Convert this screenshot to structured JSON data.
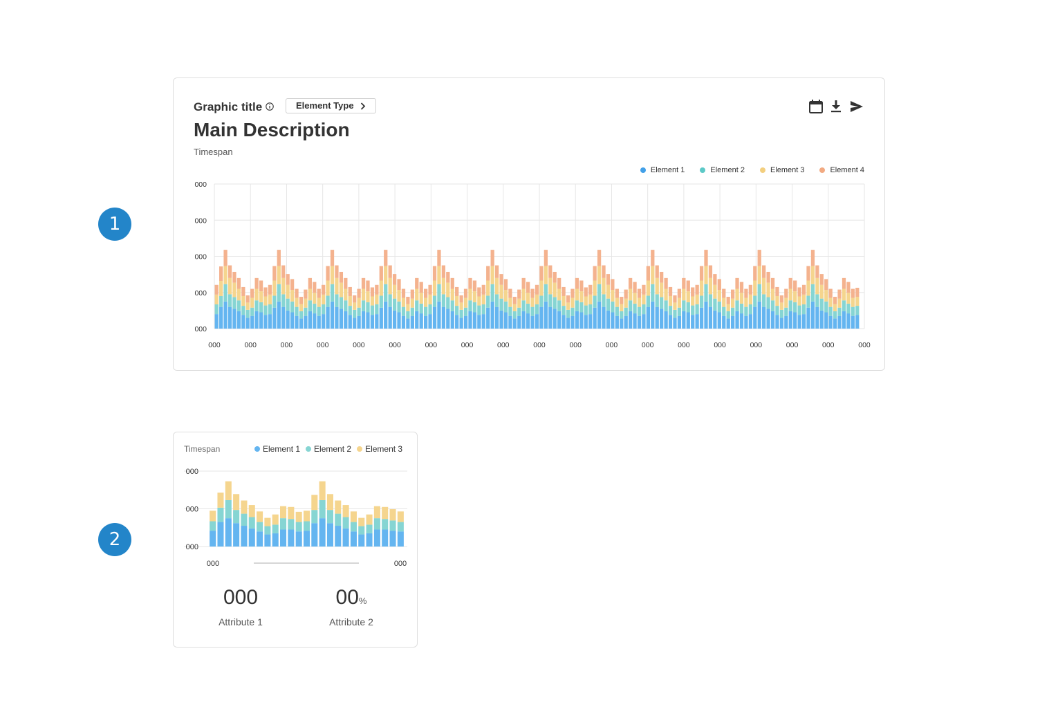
{
  "markers": [
    "1",
    "2"
  ],
  "card1": {
    "graphic_title": "Graphic title",
    "element_type_label": "Element Type",
    "main_description": "Main Description",
    "timespan": "Timespan",
    "toolbar": [
      "calendar-icon",
      "download-icon",
      "send-icon"
    ]
  },
  "card2": {
    "timespan": "Timespan",
    "kpis": [
      {
        "value": "000",
        "unit": "",
        "label": "Attribute 1"
      },
      {
        "value": "00",
        "unit": "%",
        "label": "Attribute 2"
      }
    ]
  },
  "colors": {
    "element1": "#64b5f0",
    "element2": "#86d5d3",
    "element3": "#f5d58e",
    "element4": "#f4b28e",
    "marker": "#2385c9"
  },
  "chart_data": [
    {
      "type": "bar",
      "stacked": true,
      "legend_position": "top-right",
      "grid": true,
      "y_tick_labels": [
        "000",
        "000",
        "000",
        "000",
        "000"
      ],
      "x_tick_labels": [
        "000",
        "000",
        "000",
        "000",
        "000",
        "000",
        "000",
        "000",
        "000",
        "000",
        "000",
        "000",
        "000",
        "000",
        "000",
        "000",
        "000",
        "000",
        "000"
      ],
      "ylim": [
        0,
        4
      ],
      "series": [
        {
          "name": "Element 1",
          "values": [
            0.4,
            0.6,
            0.75,
            0.6,
            0.55,
            0.48,
            0.38,
            0.3,
            0.35,
            0.48,
            0.45,
            0.38,
            0.4,
            0.58,
            0.75,
            0.6,
            0.5,
            0.45,
            0.35,
            0.28,
            0.35,
            0.48,
            0.42,
            0.35,
            0.4,
            0.6,
            0.75,
            0.6,
            0.55,
            0.48,
            0.38,
            0.3,
            0.35,
            0.48,
            0.45,
            0.38,
            0.4,
            0.58,
            0.75,
            0.6,
            0.5,
            0.45,
            0.35,
            0.28,
            0.35,
            0.48,
            0.42,
            0.35,
            0.4,
            0.6,
            0.75,
            0.6,
            0.55,
            0.48,
            0.38,
            0.3,
            0.35,
            0.48,
            0.45,
            0.38,
            0.4,
            0.58,
            0.75,
            0.6,
            0.5,
            0.45,
            0.35,
            0.28,
            0.35,
            0.48,
            0.42,
            0.35,
            0.4,
            0.6,
            0.75,
            0.6,
            0.55,
            0.48,
            0.38,
            0.3,
            0.35,
            0.48,
            0.45,
            0.38,
            0.4,
            0.58,
            0.75,
            0.6,
            0.5,
            0.45,
            0.35,
            0.28,
            0.35,
            0.48,
            0.42,
            0.35,
            0.4,
            0.6,
            0.75,
            0.6,
            0.55,
            0.48,
            0.38,
            0.3,
            0.35,
            0.48,
            0.45,
            0.38,
            0.4,
            0.58,
            0.75,
            0.6,
            0.5,
            0.45,
            0.35,
            0.28,
            0.35,
            0.48,
            0.42,
            0.35,
            0.4,
            0.6,
            0.75,
            0.6,
            0.55,
            0.48,
            0.38,
            0.3,
            0.35,
            0.48,
            0.45,
            0.38,
            0.4,
            0.58,
            0.75,
            0.6,
            0.5,
            0.45,
            0.35,
            0.28,
            0.35,
            0.48,
            0.42,
            0.35,
            0.38
          ]
        },
        {
          "name": "Element 2",
          "values": [
            0.27,
            0.3,
            0.48,
            0.35,
            0.32,
            0.3,
            0.25,
            0.22,
            0.23,
            0.3,
            0.28,
            0.26,
            0.27,
            0.33,
            0.48,
            0.35,
            0.33,
            0.3,
            0.25,
            0.2,
            0.23,
            0.3,
            0.27,
            0.25,
            0.27,
            0.31,
            0.48,
            0.35,
            0.32,
            0.3,
            0.25,
            0.22,
            0.23,
            0.3,
            0.28,
            0.26,
            0.27,
            0.33,
            0.48,
            0.35,
            0.33,
            0.3,
            0.25,
            0.2,
            0.23,
            0.3,
            0.27,
            0.25,
            0.27,
            0.31,
            0.48,
            0.35,
            0.32,
            0.3,
            0.25,
            0.22,
            0.23,
            0.3,
            0.28,
            0.26,
            0.27,
            0.33,
            0.48,
            0.35,
            0.33,
            0.3,
            0.25,
            0.2,
            0.23,
            0.3,
            0.27,
            0.25,
            0.27,
            0.31,
            0.48,
            0.35,
            0.32,
            0.3,
            0.25,
            0.22,
            0.23,
            0.3,
            0.28,
            0.26,
            0.27,
            0.33,
            0.48,
            0.35,
            0.33,
            0.3,
            0.25,
            0.2,
            0.23,
            0.3,
            0.27,
            0.25,
            0.27,
            0.31,
            0.48,
            0.35,
            0.32,
            0.3,
            0.25,
            0.22,
            0.23,
            0.3,
            0.28,
            0.26,
            0.27,
            0.33,
            0.48,
            0.35,
            0.33,
            0.3,
            0.25,
            0.2,
            0.23,
            0.3,
            0.27,
            0.25,
            0.27,
            0.31,
            0.48,
            0.35,
            0.32,
            0.3,
            0.25,
            0.22,
            0.23,
            0.3,
            0.28,
            0.26,
            0.27,
            0.33,
            0.48,
            0.35,
            0.33,
            0.3,
            0.25,
            0.2,
            0.23,
            0.3,
            0.27,
            0.25,
            0.25
          ]
        },
        {
          "name": "Element 3",
          "values": [
            0.27,
            0.42,
            0.5,
            0.45,
            0.4,
            0.32,
            0.27,
            0.2,
            0.27,
            0.32,
            0.3,
            0.25,
            0.27,
            0.42,
            0.5,
            0.45,
            0.38,
            0.32,
            0.25,
            0.2,
            0.25,
            0.32,
            0.3,
            0.25,
            0.27,
            0.42,
            0.5,
            0.45,
            0.4,
            0.32,
            0.27,
            0.2,
            0.27,
            0.32,
            0.3,
            0.25,
            0.27,
            0.42,
            0.5,
            0.45,
            0.38,
            0.32,
            0.25,
            0.2,
            0.25,
            0.32,
            0.3,
            0.25,
            0.27,
            0.42,
            0.5,
            0.45,
            0.4,
            0.32,
            0.27,
            0.2,
            0.27,
            0.32,
            0.3,
            0.25,
            0.27,
            0.42,
            0.5,
            0.45,
            0.38,
            0.32,
            0.25,
            0.2,
            0.25,
            0.32,
            0.3,
            0.25,
            0.27,
            0.42,
            0.5,
            0.45,
            0.4,
            0.32,
            0.27,
            0.2,
            0.27,
            0.32,
            0.3,
            0.25,
            0.27,
            0.42,
            0.5,
            0.45,
            0.38,
            0.32,
            0.25,
            0.2,
            0.25,
            0.32,
            0.3,
            0.25,
            0.27,
            0.42,
            0.5,
            0.45,
            0.4,
            0.32,
            0.27,
            0.2,
            0.27,
            0.32,
            0.3,
            0.25,
            0.27,
            0.42,
            0.5,
            0.45,
            0.38,
            0.32,
            0.25,
            0.2,
            0.25,
            0.32,
            0.3,
            0.25,
            0.27,
            0.42,
            0.5,
            0.45,
            0.4,
            0.32,
            0.27,
            0.2,
            0.27,
            0.32,
            0.3,
            0.25,
            0.27,
            0.42,
            0.5,
            0.45,
            0.38,
            0.32,
            0.25,
            0.2,
            0.25,
            0.32,
            0.3,
            0.25,
            0.25
          ]
        },
        {
          "name": "Element 4",
          "values": [
            0.27,
            0.4,
            0.45,
            0.35,
            0.3,
            0.3,
            0.25,
            0.2,
            0.25,
            0.3,
            0.3,
            0.25,
            0.27,
            0.4,
            0.45,
            0.35,
            0.3,
            0.3,
            0.25,
            0.2,
            0.25,
            0.3,
            0.3,
            0.25,
            0.27,
            0.4,
            0.45,
            0.35,
            0.3,
            0.3,
            0.25,
            0.2,
            0.25,
            0.3,
            0.3,
            0.25,
            0.27,
            0.4,
            0.45,
            0.35,
            0.3,
            0.3,
            0.25,
            0.2,
            0.25,
            0.3,
            0.3,
            0.25,
            0.27,
            0.4,
            0.45,
            0.35,
            0.3,
            0.3,
            0.25,
            0.2,
            0.25,
            0.3,
            0.3,
            0.25,
            0.27,
            0.4,
            0.45,
            0.35,
            0.3,
            0.3,
            0.25,
            0.2,
            0.25,
            0.3,
            0.3,
            0.25,
            0.27,
            0.4,
            0.45,
            0.35,
            0.3,
            0.3,
            0.25,
            0.2,
            0.25,
            0.3,
            0.3,
            0.25,
            0.27,
            0.4,
            0.45,
            0.35,
            0.3,
            0.3,
            0.25,
            0.2,
            0.25,
            0.3,
            0.3,
            0.25,
            0.27,
            0.4,
            0.45,
            0.35,
            0.3,
            0.3,
            0.25,
            0.2,
            0.25,
            0.3,
            0.3,
            0.25,
            0.27,
            0.4,
            0.45,
            0.35,
            0.3,
            0.3,
            0.25,
            0.2,
            0.25,
            0.3,
            0.3,
            0.25,
            0.27,
            0.4,
            0.45,
            0.35,
            0.3,
            0.3,
            0.25,
            0.2,
            0.25,
            0.3,
            0.3,
            0.25,
            0.27,
            0.4,
            0.45,
            0.35,
            0.3,
            0.3,
            0.25,
            0.2,
            0.25,
            0.3,
            0.3,
            0.25,
            0.25
          ]
        }
      ]
    },
    {
      "type": "bar",
      "stacked": true,
      "legend_position": "top-right",
      "grid": true,
      "y_tick_labels": [
        "000",
        "000",
        "000"
      ],
      "x_tick_labels": [
        "000",
        "000"
      ],
      "ylim": [
        0,
        2
      ],
      "series": [
        {
          "name": "Element 1",
          "values": [
            0.42,
            0.65,
            0.75,
            0.62,
            0.55,
            0.48,
            0.4,
            0.32,
            0.35,
            0.45,
            0.45,
            0.4,
            0.42,
            0.62,
            0.75,
            0.62,
            0.55,
            0.48,
            0.4,
            0.32,
            0.35,
            0.45,
            0.45,
            0.42,
            0.4
          ]
        },
        {
          "name": "Element 2",
          "values": [
            0.25,
            0.38,
            0.48,
            0.35,
            0.32,
            0.3,
            0.25,
            0.22,
            0.23,
            0.3,
            0.28,
            0.25,
            0.25,
            0.35,
            0.48,
            0.35,
            0.32,
            0.3,
            0.25,
            0.22,
            0.23,
            0.3,
            0.28,
            0.27,
            0.25
          ]
        },
        {
          "name": "Element 3",
          "values": [
            0.28,
            0.4,
            0.5,
            0.42,
            0.35,
            0.32,
            0.28,
            0.22,
            0.27,
            0.32,
            0.32,
            0.27,
            0.28,
            0.4,
            0.5,
            0.42,
            0.35,
            0.32,
            0.28,
            0.22,
            0.27,
            0.32,
            0.32,
            0.3,
            0.28
          ]
        }
      ]
    }
  ]
}
